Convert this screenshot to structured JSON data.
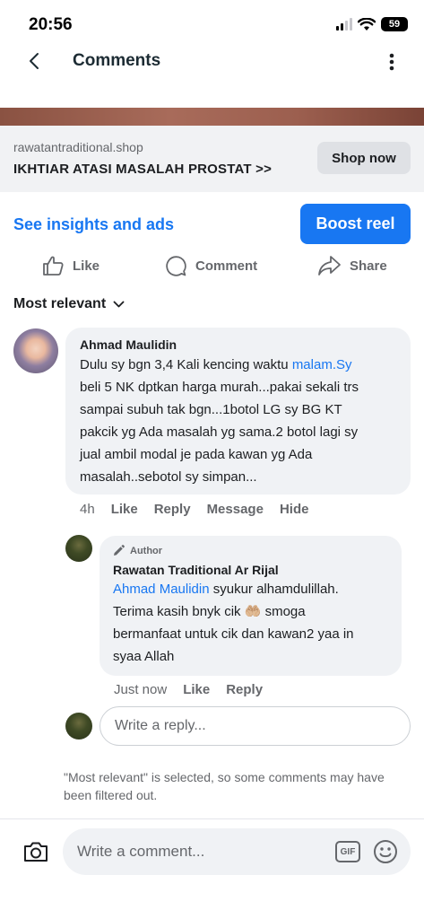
{
  "status_bar": {
    "time": "20:56",
    "battery": "59"
  },
  "header": {
    "title": "Comments"
  },
  "ad": {
    "domain": "rawatantraditional.shop",
    "headline": "IKHTIAR ATASI MASALAH PROSTAT >>",
    "cta": "Shop now"
  },
  "insights": {
    "link": "See insights and ads",
    "boost": "Boost reel"
  },
  "actions": {
    "like": "Like",
    "comment": "Comment",
    "share": "Share"
  },
  "sort": {
    "label": "Most relevant"
  },
  "comments": [
    {
      "author": "Ahmad Maulidin",
      "lines": [
        {
          "text": "Dulu sy bgn 3,4 Kali kencing waktu ",
          "link": "malam.Sy"
        },
        {
          "text": "beli 5 NK dptkan harga murah...pakai sekali trs"
        },
        {
          "text": "sampai subuh tak bgn...1botol LG sy BG KT"
        },
        {
          "text": "pakcik yg Ada masalah yg sama.2 botol lagi sy"
        },
        {
          "text": "jual ambil modal je pada kawan yg Ada"
        },
        {
          "text": "masalah..sebotol sy simpan..."
        }
      ],
      "time": "4h",
      "like": "Like",
      "reply": "Reply",
      "message": "Message",
      "hide": "Hide"
    }
  ],
  "reply": {
    "badge": "Author",
    "author": "Rawatan Traditional Ar Rijal",
    "mention": "Ahmad Maulidin",
    "line1_rest": " syukur alhamdulillah.",
    "line2_before": "Terima kasih bnyk cik ",
    "line2_emoji": "🤲🏼",
    "line2_after": " smoga",
    "line3": "bermanfaat untuk cik dan kawan2 yaa in",
    "line4": "syaa Allah",
    "time": "Just now",
    "like": "Like",
    "reply": "Reply"
  },
  "write_reply": {
    "placeholder": "Write a reply..."
  },
  "filter_note": "\"Most relevant\" is selected, so some comments may have been filtered out.",
  "composer": {
    "placeholder": "Write a comment...",
    "gif": "GIF"
  },
  "colors": {
    "accent": "#1877f2",
    "bubble": "#f0f2f5",
    "muted": "#65676b"
  }
}
